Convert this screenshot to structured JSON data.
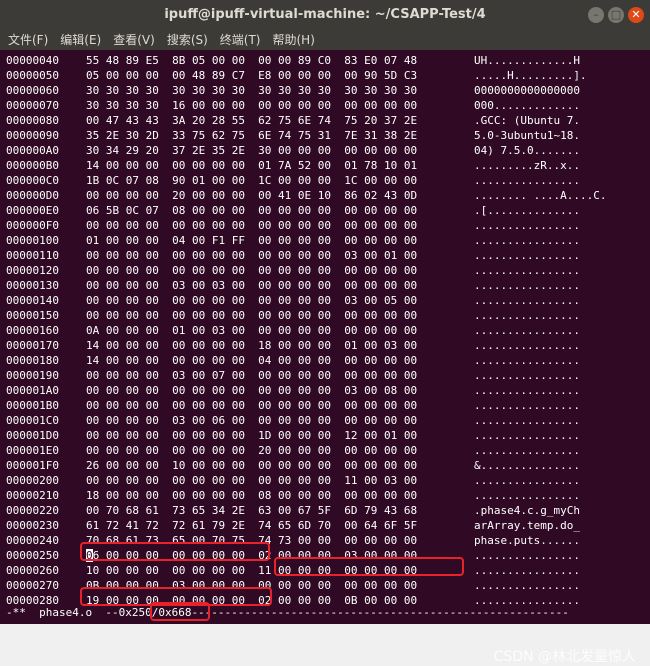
{
  "window": {
    "title": "ipuff@ipuff-virtual-machine: ~/CSAPP-Test/4",
    "buttons": [
      "–",
      "□",
      "✕"
    ]
  },
  "menubar": [
    {
      "label": "文件(F)"
    },
    {
      "label": "编辑(E)"
    },
    {
      "label": "查看(V)"
    },
    {
      "label": "搜索(S)"
    },
    {
      "label": "终端(T)"
    },
    {
      "label": "帮助(H)"
    }
  ],
  "hex_rows": [
    {
      "offset": "00000040",
      "hex": "55 48 89 E5  8B 05 00 00  00 00 89 C0  83 E0 07 48",
      "ascii": "UH.............H"
    },
    {
      "offset": "00000050",
      "hex": "05 00 00 00  00 48 89 C7  E8 00 00 00  00 90 5D C3",
      "ascii": ".....H.........]."
    },
    {
      "offset": "00000060",
      "hex": "30 30 30 30  30 30 30 30  30 30 30 30  30 30 30 30",
      "ascii": "0000000000000000"
    },
    {
      "offset": "00000070",
      "hex": "30 30 30 30  16 00 00 00  00 00 00 00  00 00 00 00",
      "ascii": "000............."
    },
    {
      "offset": "00000080",
      "hex": "00 47 43 43  3A 20 28 55  62 75 6E 74  75 20 37 2E",
      "ascii": ".GCC: (Ubuntu 7."
    },
    {
      "offset": "00000090",
      "hex": "35 2E 30 2D  33 75 62 75  6E 74 75 31  7E 31 38 2E",
      "ascii": "5.0-3ubuntu1~18."
    },
    {
      "offset": "000000A0",
      "hex": "30 34 29 20  37 2E 35 2E  30 00 00 00  00 00 00 00",
      "ascii": "04) 7.5.0......."
    },
    {
      "offset": "000000B0",
      "hex": "14 00 00 00  00 00 00 00  01 7A 52 00  01 78 10 01",
      "ascii": ".........zR..x.."
    },
    {
      "offset": "000000C0",
      "hex": "1B 0C 07 08  90 01 00 00  1C 00 00 00  1C 00 00 00",
      "ascii": "................"
    },
    {
      "offset": "000000D0",
      "hex": "00 00 00 00  20 00 00 00  00 41 0E 10  86 02 43 0D",
      "ascii": "........ ....A....C."
    },
    {
      "offset": "000000E0",
      "hex": "06 5B 0C 07  08 00 00 00  00 00 00 00  00 00 00 00",
      "ascii": ".[.............."
    },
    {
      "offset": "000000F0",
      "hex": "00 00 00 00  00 00 00 00  00 00 00 00  00 00 00 00",
      "ascii": "................"
    },
    {
      "offset": "00000100",
      "hex": "01 00 00 00  04 00 F1 FF  00 00 00 00  00 00 00 00",
      "ascii": "................"
    },
    {
      "offset": "00000110",
      "hex": "00 00 00 00  00 00 00 00  00 00 00 00  03 00 01 00",
      "ascii": "................"
    },
    {
      "offset": "00000120",
      "hex": "00 00 00 00  00 00 00 00  00 00 00 00  00 00 00 00",
      "ascii": "................"
    },
    {
      "offset": "00000130",
      "hex": "00 00 00 00  03 00 03 00  00 00 00 00  00 00 00 00",
      "ascii": "................"
    },
    {
      "offset": "00000140",
      "hex": "00 00 00 00  00 00 00 00  00 00 00 00  03 00 05 00",
      "ascii": "................"
    },
    {
      "offset": "00000150",
      "hex": "00 00 00 00  00 00 00 00  00 00 00 00  00 00 00 00",
      "ascii": "................"
    },
    {
      "offset": "00000160",
      "hex": "0A 00 00 00  01 00 03 00  00 00 00 00  00 00 00 00",
      "ascii": "................"
    },
    {
      "offset": "00000170",
      "hex": "14 00 00 00  00 00 00 00  18 00 00 00  01 00 03 00",
      "ascii": "................"
    },
    {
      "offset": "00000180",
      "hex": "14 00 00 00  00 00 00 00  04 00 00 00  00 00 00 00",
      "ascii": "................"
    },
    {
      "offset": "00000190",
      "hex": "00 00 00 00  03 00 07 00  00 00 00 00  00 00 00 00",
      "ascii": "................"
    },
    {
      "offset": "000001A0",
      "hex": "00 00 00 00  00 00 00 00  00 00 00 00  03 00 08 00",
      "ascii": "................"
    },
    {
      "offset": "000001B0",
      "hex": "00 00 00 00  00 00 00 00  00 00 00 00  00 00 00 00",
      "ascii": "................"
    },
    {
      "offset": "000001C0",
      "hex": "00 00 00 00  03 00 06 00  00 00 00 00  00 00 00 00",
      "ascii": "................"
    },
    {
      "offset": "000001D0",
      "hex": "00 00 00 00  00 00 00 00  1D 00 00 00  12 00 01 00",
      "ascii": "................"
    },
    {
      "offset": "000001E0",
      "hex": "00 00 00 00  00 00 00 00  20 00 00 00  00 00 00 00",
      "ascii": "................"
    },
    {
      "offset": "000001F0",
      "hex": "26 00 00 00  10 00 00 00  00 00 00 00  00 00 00 00",
      "ascii": "&..............."
    },
    {
      "offset": "00000200",
      "hex": "00 00 00 00  00 00 00 00  00 00 00 00  11 00 03 00",
      "ascii": "................"
    },
    {
      "offset": "00000210",
      "hex": "18 00 00 00  00 00 00 00  08 00 00 00  00 00 00 00",
      "ascii": "................"
    },
    {
      "offset": "00000220",
      "hex": "00 70 68 61  73 65 34 2E  63 00 67 5F  6D 79 43 68",
      "ascii": ".phase4.c.g_myCh"
    },
    {
      "offset": "00000230",
      "hex": "61 72 41 72  72 61 79 2E  74 65 6D 70  00 64 6F 5F",
      "ascii": "arArray.temp.do_"
    },
    {
      "offset": "00000240",
      "hex": "70 68 61 73  65 00 70 75  74 73 00 00  00 00 00 00",
      "ascii": "phase.puts......"
    },
    {
      "offset": "00000250",
      "hex": "06 00 00 00  00 00 00 00  02 00 00 00  03 00 00 00",
      "ascii": "................"
    },
    {
      "offset": "00000260",
      "hex": "10 00 00 00  00 00 00 00  11 00 00 00  00 00 00 00",
      "ascii": "................"
    },
    {
      "offset": "00000270",
      "hex": "0B 00 00 00  03 00 00 00  00 00 00 00  00 00 00 00",
      "ascii": "................"
    },
    {
      "offset": "00000280",
      "hex": "19 00 00 00  00 00 00 00  02 00 00 00  0B 00 00 00",
      "ascii": "................"
    }
  ],
  "cursor_first_char": "0",
  "status_bar": {
    "left": "-**  phase4.o",
    "position": "--0x250",
    "total": "/0x668---------------------------------------------------------"
  },
  "watermark": "CSDN @林北发量惊人",
  "highlight_color": "#e8212b"
}
